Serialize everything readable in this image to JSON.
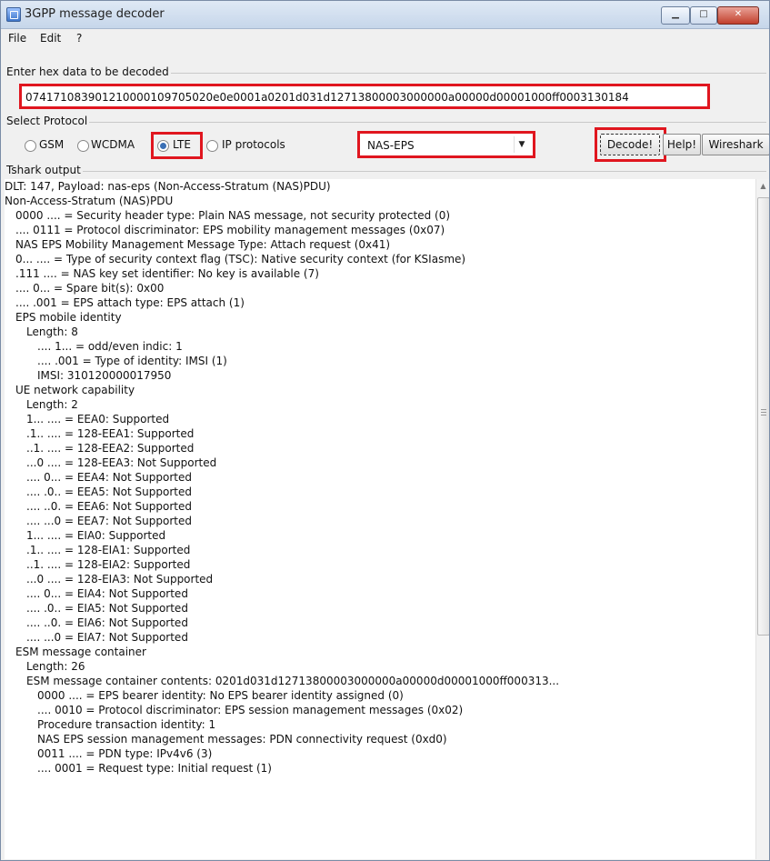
{
  "window": {
    "title": "3GPP message decoder"
  },
  "menu": [
    "File",
    "Edit",
    "?"
  ],
  "hex": {
    "label": "Enter hex data to be decoded",
    "value": "074171083901210000109705020e0e0001a0201d031d12713800003000000a00000d00001000ff0003130184"
  },
  "protocol": {
    "label": "Select Protocol",
    "options": [
      "GSM",
      "WCDMA",
      "LTE",
      "IP protocols"
    ],
    "selected": "NAS-EPS"
  },
  "buttons": {
    "decode": "Decode!",
    "help": "Help!",
    "wireshark": "Wireshark"
  },
  "output": {
    "label": "Tshark output",
    "lines": [
      "DLT: 147, Payload: nas-eps (Non-Access-Stratum (NAS)PDU)",
      "Non-Access-Stratum (NAS)PDU",
      "0000 .... = Security header type: Plain NAS message, not security protected (0)",
      ".... 0111 = Protocol discriminator: EPS mobility management messages (0x07)",
      "NAS EPS Mobility Management Message Type: Attach request (0x41)",
      "0... .... = Type of security context flag (TSC): Native security context (for KSIasme)",
      ".111 .... = NAS key set identifier: No key is available (7)",
      ".... 0... = Spare bit(s): 0x00",
      ".... .001 = EPS attach type: EPS attach (1)",
      "EPS mobile identity",
      "Length: 8",
      ".... 1... = odd/even indic: 1",
      ".... .001 = Type of identity: IMSI (1)",
      "IMSI: 310120000017950",
      "UE network capability",
      "Length: 2",
      "1... .... = EEA0: Supported",
      ".1.. .... = 128-EEA1: Supported",
      "..1. .... = 128-EEA2: Supported",
      "...0 .... = 128-EEA3: Not Supported",
      ".... 0... = EEA4: Not Supported",
      ".... .0.. = EEA5: Not Supported",
      ".... ..0. = EEA6: Not Supported",
      ".... ...0 = EEA7: Not Supported",
      "1... .... = EIA0: Supported",
      ".1.. .... = 128-EIA1: Supported",
      "..1. .... = 128-EIA2: Supported",
      "...0 .... = 128-EIA3: Not Supported",
      ".... 0... = EIA4: Not Supported",
      ".... .0.. = EIA5: Not Supported",
      ".... ..0. = EIA6: Not Supported",
      ".... ...0 = EIA7: Not Supported",
      "ESM message container",
      "Length: 26",
      "ESM message container contents: 0201d031d12713800003000000a00000d00001000ff000313...",
      "0000 .... = EPS bearer identity: No EPS bearer identity assigned (0)",
      ".... 0010 = Protocol discriminator: EPS session management messages (0x02)",
      "Procedure transaction identity: 1",
      "NAS EPS session management messages: PDN connectivity request (0xd0)",
      "0011 .... = PDN type: IPv4v6 (3)",
      ".... 0001 = Request type: Initial request (1)"
    ]
  }
}
